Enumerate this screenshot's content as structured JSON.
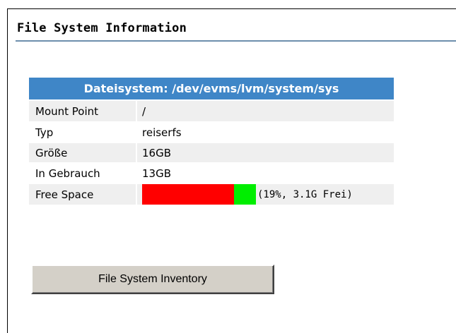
{
  "section": {
    "title": "File System Information"
  },
  "filesystem": {
    "header": "Dateisystem:  /dev/evms/lvm/system/sys",
    "rows": [
      {
        "label": "Mount Point",
        "value": "/"
      },
      {
        "label": "Typ",
        "value": "reiserfs"
      },
      {
        "label": "Größe",
        "value": "16GB"
      },
      {
        "label": "In Gebrauch",
        "value": "13GB"
      }
    ],
    "free_space": {
      "label": "Free Space",
      "text": "(19%, 3.1G Frei)",
      "free_percent": 19,
      "used_color": "#ff0000",
      "free_color": "#00ee00"
    }
  },
  "actions": {
    "inventory_label": "File System Inventory"
  }
}
